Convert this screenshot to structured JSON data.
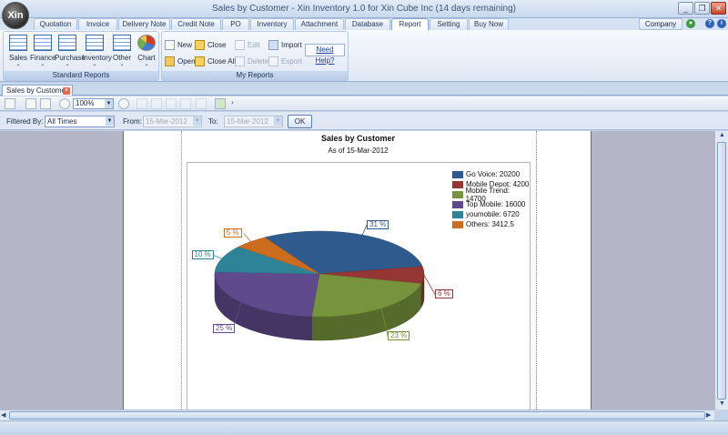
{
  "window": {
    "title": "Sales by Customer - Xin Inventory 1.0 for Xin Cube Inc (14 days remaining)",
    "orb_label": "Xin"
  },
  "tabs": [
    {
      "label": "Quotation"
    },
    {
      "label": "Invoice"
    },
    {
      "label": "Delivery Note"
    },
    {
      "label": "Credit Note"
    },
    {
      "label": "PO"
    },
    {
      "label": "Inventory"
    },
    {
      "label": "Attachment"
    },
    {
      "label": "Database"
    },
    {
      "label": "Report"
    },
    {
      "label": "Setting"
    },
    {
      "label": "Buy Now"
    }
  ],
  "active_tab": "Report",
  "company_label": "Company",
  "ribbon": {
    "standard_reports": {
      "label": "Standard Reports",
      "buttons": [
        {
          "label": "Sales"
        },
        {
          "label": "Finance"
        },
        {
          "label": "Purchase"
        },
        {
          "label": "Inventory"
        },
        {
          "label": "Other"
        },
        {
          "label": "Chart"
        }
      ]
    },
    "my_reports": {
      "label": "My Reports",
      "new": "New",
      "open": "Open",
      "close": "Close",
      "close_all": "Close All",
      "edit": "Edit",
      "delete": "Delete",
      "import": "Import",
      "export": "Export"
    },
    "help": "Need Help?"
  },
  "document_tab": "Sales by Customer",
  "toolbar": {
    "zoom": "100%"
  },
  "filter": {
    "filtered_by_label": "Filtered By:",
    "filtered_by_value": "All Times",
    "from_label": "From:",
    "from_value": "15-Mar-2012",
    "to_label": "To:",
    "to_value": "15-Mar-2012",
    "ok_label": "OK"
  },
  "report": {
    "title": "Sales by Customer",
    "subtitle": "As of 15-Mar-2012"
  },
  "colors": {
    "go_voice": "#2e5a8e",
    "mobile_depot": "#943634",
    "mobile_trend": "#77933c",
    "top_mobile": "#5f4a8b",
    "youmobile": "#2f8399",
    "others": "#cc6c1f"
  },
  "chart_data": {
    "type": "pie",
    "categories": [
      "Go Voice",
      "Mobile Depot",
      "Mobile Trend",
      "Top Mobile",
      "youmobile",
      "Others"
    ],
    "values": [
      20200,
      4200,
      14700,
      16000,
      6720,
      3412.5
    ],
    "legend": [
      "Go Voice: 20200",
      "Mobile Depot: 4200",
      "Mobile Trend: 14700",
      "Top Mobile: 16000",
      "youmobile: 6720",
      "Others: 3412.5"
    ],
    "data_labels": [
      "31 %",
      "6 %",
      "23 %",
      "25 %",
      "10 %",
      "5 %"
    ],
    "title": "Sales by Customer",
    "legend_position": "top-right"
  }
}
